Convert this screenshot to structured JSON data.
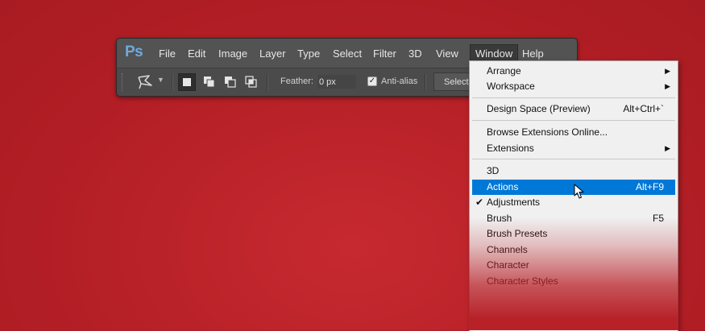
{
  "app": {
    "logo": "Ps"
  },
  "menubar": {
    "items": [
      "File",
      "Edit",
      "Image",
      "Layer",
      "Type",
      "Select",
      "Filter",
      "3D",
      "View",
      "Window",
      "Help"
    ],
    "active": "Window"
  },
  "options": {
    "tool_icon": "polygonal-lasso-icon",
    "feather_label": "Feather:",
    "feather_value": "0 px",
    "antialias_label": "Anti-alias",
    "antialias_checked": true,
    "select_button": "Select and Mask..."
  },
  "dropdown": {
    "items": [
      {
        "label": "Arrange",
        "submenu": true
      },
      {
        "label": "Workspace",
        "submenu": true
      },
      {
        "label": "Design Space (Preview)",
        "shortcut": "Alt+Ctrl+`"
      },
      {
        "label": "Browse Extensions Online..."
      },
      {
        "label": "Extensions",
        "submenu": true
      },
      {
        "label": "3D"
      },
      {
        "label": "Actions",
        "shortcut": "Alt+F9",
        "highlighted": true
      },
      {
        "label": "Adjustments",
        "checked": true
      },
      {
        "label": "Brush",
        "shortcut": "F5"
      },
      {
        "label": "Brush Presets"
      },
      {
        "label": "Channels"
      },
      {
        "label": "Character"
      },
      {
        "label": "Character Styles"
      }
    ]
  },
  "colors": {
    "background": "#b51f26",
    "highlight": "#0078d7",
    "ps_blue": "#6fa8dc"
  }
}
